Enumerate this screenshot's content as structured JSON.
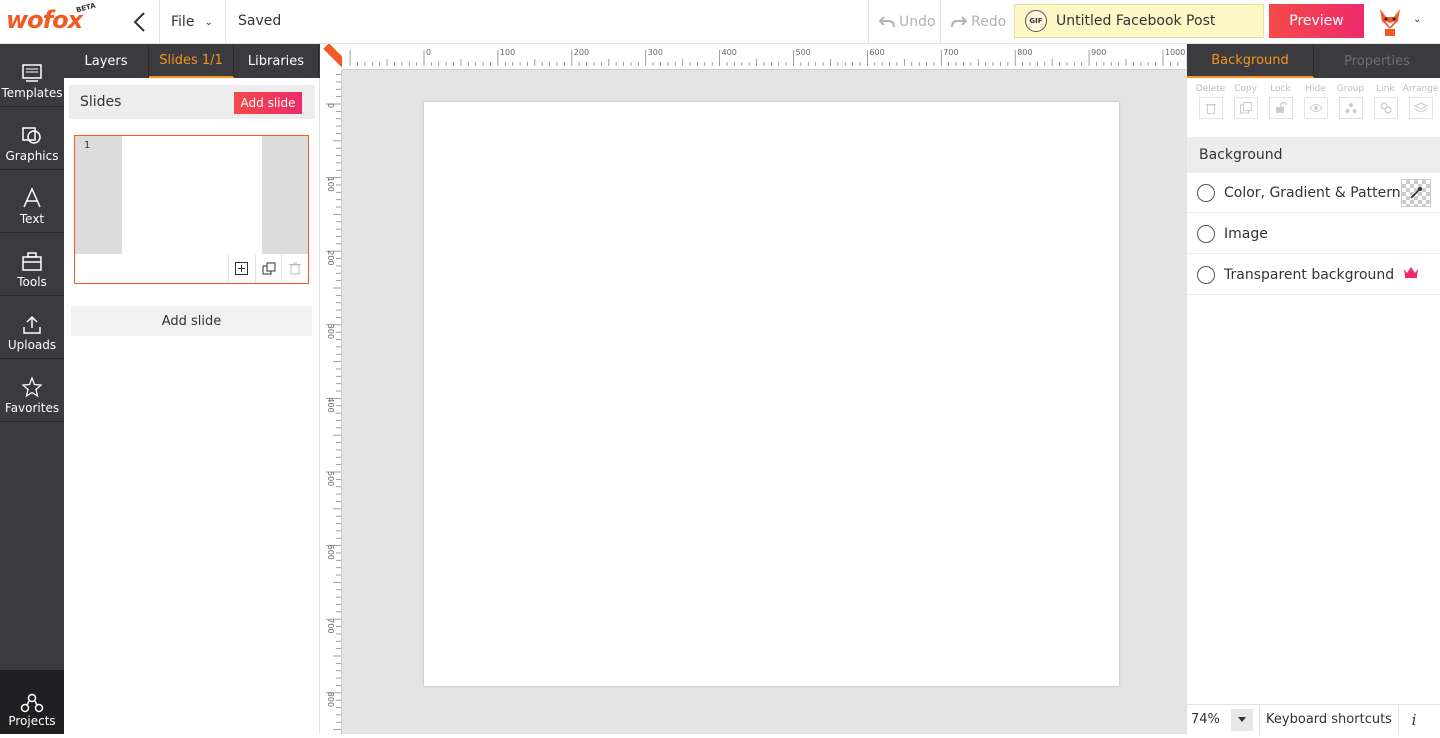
{
  "header": {
    "logo": "wofox",
    "logo_beta": "BETA",
    "file_label": "File",
    "saved_label": "Saved",
    "undo_label": "Undo",
    "redo_label": "Redo",
    "gif_badge": "GIF",
    "document_title": "Untitled Facebook Post",
    "preview_label": "Preview"
  },
  "leftnav": {
    "items": [
      {
        "label": "Templates",
        "icon": "templates-icon"
      },
      {
        "label": "Graphics",
        "icon": "graphics-icon"
      },
      {
        "label": "Text",
        "icon": "text-icon"
      },
      {
        "label": "Tools",
        "icon": "tools-icon"
      },
      {
        "label": "Uploads",
        "icon": "upload-icon"
      },
      {
        "label": "Favorites",
        "icon": "star-icon"
      }
    ],
    "projects_label": "Projects"
  },
  "panel": {
    "tabs": [
      "Layers",
      "Slides 1/1",
      "Libraries"
    ],
    "active_tab": "Slides 1/1",
    "slides_title": "Slides",
    "add_slide_button": "Add slide",
    "slide_number": "1",
    "add_slide_bottom": "Add slide"
  },
  "ruler": {
    "top_labels": [
      "0",
      "100",
      "200",
      "300",
      "400",
      "500",
      "600",
      "700",
      "800",
      "900",
      "1000"
    ],
    "left_labels": [
      "0",
      "100",
      "200",
      "300",
      "400",
      "500",
      "600",
      "700",
      "800"
    ]
  },
  "right_panel": {
    "tabs": [
      "Background",
      "Properties"
    ],
    "active_tab": "Background",
    "tools": [
      "Delete",
      "Copy",
      "Lock",
      "Hide",
      "Group",
      "Link",
      "Arrange"
    ],
    "section_title": "Background",
    "options": [
      "Color, Gradient & Pattern",
      "Image",
      "Transparent background"
    ],
    "zoom": "74%",
    "keyboard_shortcuts": "Keyboard shortcuts",
    "info": "i"
  },
  "colors": {
    "accent": "#f7941d",
    "brand": "#f15a24",
    "nav_bg": "#3b3b3f",
    "canvas_bg": "#e4e4e4"
  }
}
